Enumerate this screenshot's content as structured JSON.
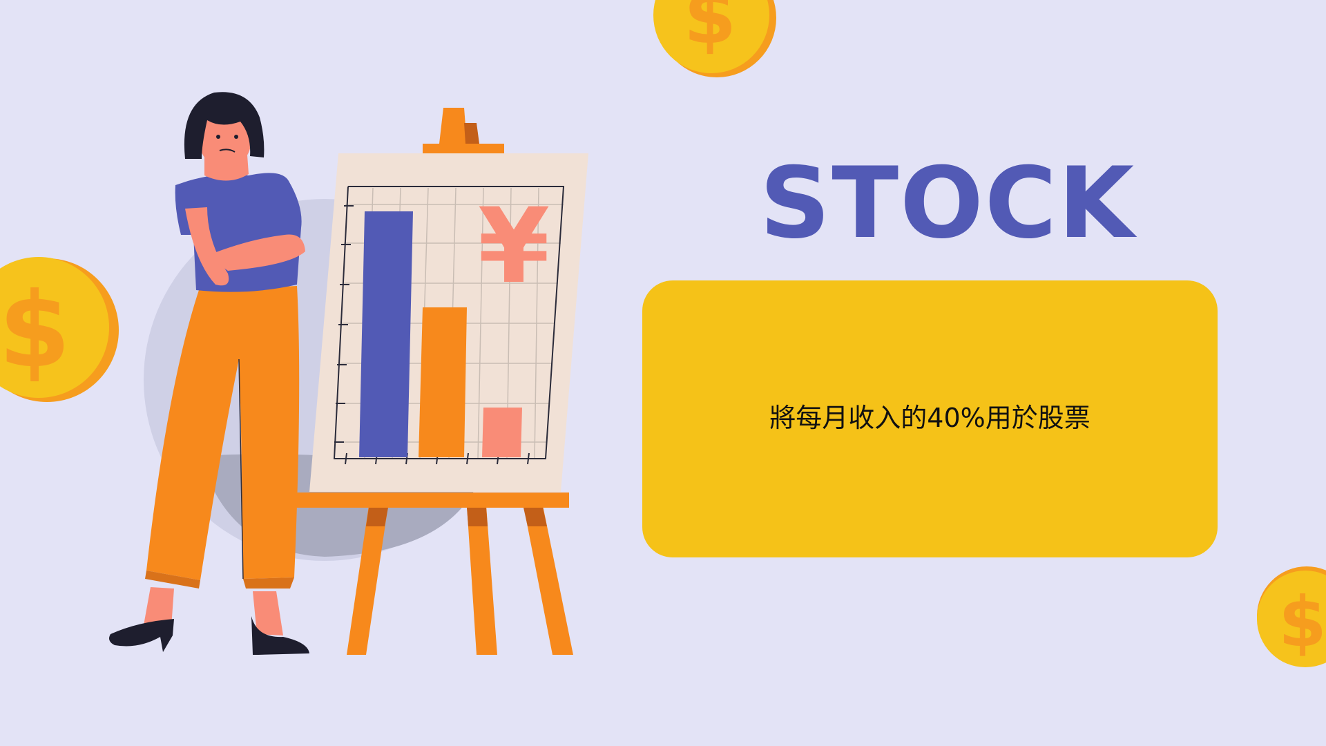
{
  "slide": {
    "title": "STOCK",
    "card_text": "將每月收入的40%用於股票",
    "board_symbol": "¥",
    "coin_symbol": "$"
  },
  "colors": {
    "background": "#e3e3f6",
    "title": "#525ab5",
    "card": "#f5c218",
    "coin": "#f6c31c",
    "coin_edge": "#f69d1e",
    "bar_blue": "#525ab5",
    "bar_orange": "#f7891c",
    "bar_salmon": "#f98c77",
    "board": "#f1e1d6",
    "easel": "#f7891c"
  },
  "icons": [
    "dollar-coin-icon",
    "yen-icon",
    "bar-chart-icon"
  ]
}
